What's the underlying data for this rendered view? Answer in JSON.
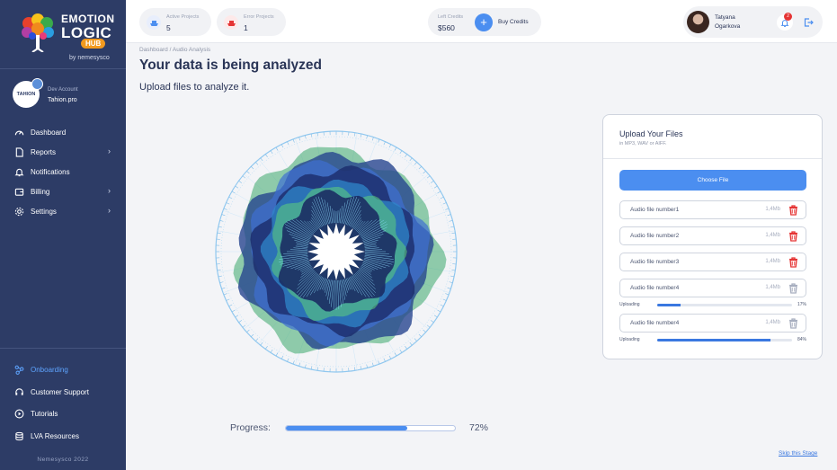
{
  "brand": {
    "line1": "EMOTION",
    "line2": "LOGIC",
    "hub": "HUB",
    "by": "by nemesysco"
  },
  "account": {
    "avatar_text": "TAHION",
    "label": "Dev Account",
    "name": "Tahion.pro"
  },
  "sidebar": {
    "items": [
      {
        "label": "Dashboard",
        "icon": "speedometer-icon",
        "has_submenu": false
      },
      {
        "label": "Reports",
        "icon": "file-icon",
        "has_submenu": true
      },
      {
        "label": "Notifications",
        "icon": "bell-icon",
        "has_submenu": false
      },
      {
        "label": "Billing",
        "icon": "wallet-icon",
        "has_submenu": true
      },
      {
        "label": "Settings",
        "icon": "gear-icon",
        "has_submenu": true
      }
    ],
    "bottom_items": [
      {
        "label": "Onboarding",
        "icon": "onboarding-icon",
        "active": true
      },
      {
        "label": "Customer Support",
        "icon": "headset-icon",
        "active": false
      },
      {
        "label": "Tutorials",
        "icon": "play-icon",
        "active": false
      },
      {
        "label": "LVA Resources",
        "icon": "database-icon",
        "active": false
      }
    ],
    "footer": "Nemesysco 2022",
    "accent_color": "#5ea4ff",
    "background": "#2d3c66"
  },
  "topbar": {
    "active_projects": {
      "label": "Active Projects",
      "value": "5",
      "icon": "ship-icon-blue"
    },
    "error_projects": {
      "label": "Error Projects",
      "value": "1",
      "icon": "ship-icon-red"
    },
    "credits": {
      "label": "Left Credits",
      "value": "$560",
      "buy_label": "Buy Credits",
      "buy_icon": "plus-icon"
    },
    "user": {
      "first_name": "Tatyana",
      "last_name": "Ogarkova",
      "notification_count": "2"
    }
  },
  "main": {
    "breadcrumb": "Dashboard / Audio Analysis",
    "title": "Your data is being analyzed",
    "subtitle": "Upload files to analyze it.",
    "progress_label": "Progress:",
    "progress_value": 72,
    "progress_text": "72%",
    "skip_label": "Skip this Stage"
  },
  "upload": {
    "title": "Upload Your Files",
    "subtitle": "in MP3, WAV or AIFF.",
    "choose_label": "Choose File",
    "files": [
      {
        "name": "Audio file number1",
        "size": "1,4Mb",
        "state": "done"
      },
      {
        "name": "Audio file number2",
        "size": "1,4Mb",
        "state": "done"
      },
      {
        "name": "Audio file number3",
        "size": "1,4Mb",
        "state": "done"
      },
      {
        "name": "Audio file number4",
        "size": "1,4Mb",
        "state": "uploading",
        "progress_label": "Uploading",
        "progress": 17,
        "progress_text": "17%"
      },
      {
        "name": "Audio file number4",
        "size": "1,4Mb",
        "state": "uploading",
        "progress_label": "Uploading",
        "progress": 84,
        "progress_text": "84%"
      }
    ],
    "delete_color_active": "#e53434",
    "delete_color_disabled": "#a7aebf"
  },
  "colors": {
    "primary": "#4b8ef0",
    "navy": "#2d3c66",
    "danger": "#e53434"
  }
}
